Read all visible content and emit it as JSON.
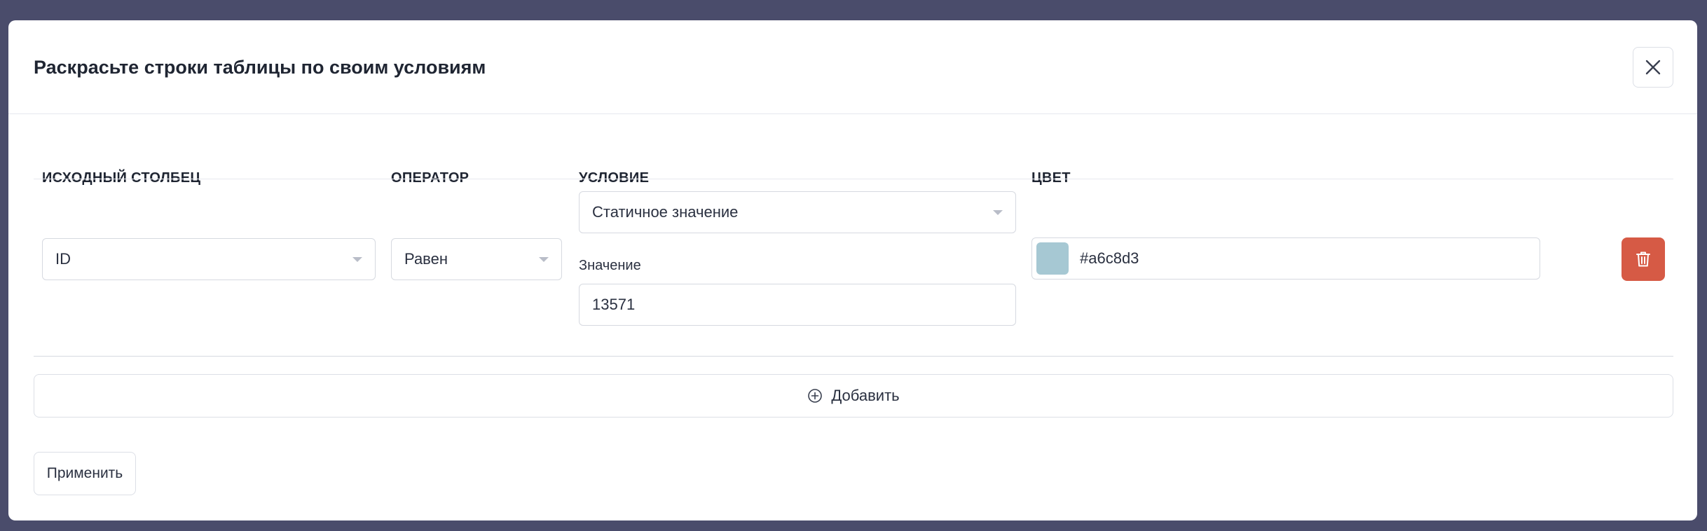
{
  "modal": {
    "title": "Раскрасьте строки таблицы по своим условиям"
  },
  "columns": {
    "source": "ИСХОДНЫЙ СТОЛБЕЦ",
    "operator": "ОПЕРАТОР",
    "condition": "УСЛОВИЕ",
    "color": "ЦВЕТ"
  },
  "rule": {
    "source_value": "ID",
    "operator_value": "Равен",
    "condition_type": "Статичное значение",
    "value_label": "Значение",
    "value": "13571",
    "color_hex": "#a6c8d3"
  },
  "actions": {
    "add_label": "Добавить",
    "apply_label": "Применить"
  },
  "colors": {
    "delete_button": "#d65a45",
    "overlay": "#4a4c6b",
    "swatch": "#a6c8d3"
  }
}
